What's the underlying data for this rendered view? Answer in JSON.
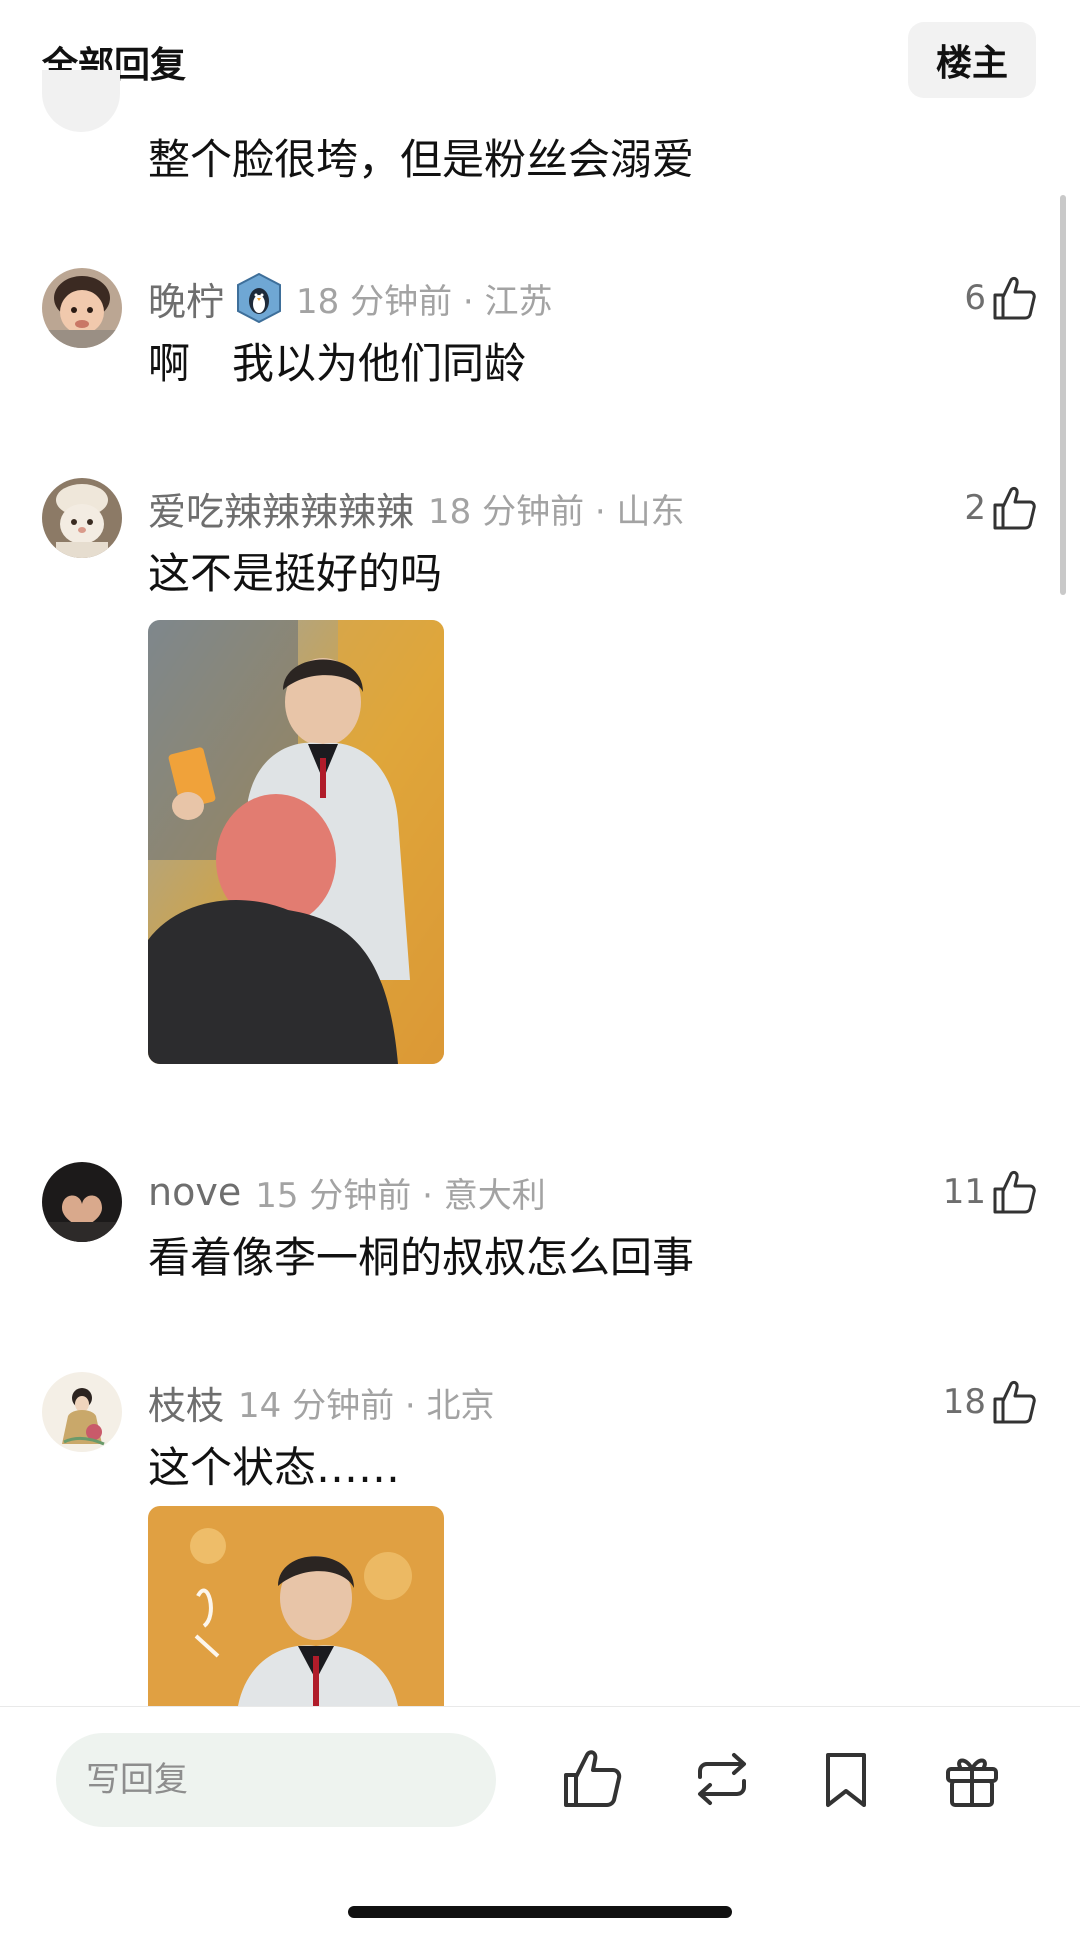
{
  "header": {
    "title": "全部回复",
    "op_button": "楼主"
  },
  "partial_comment": {
    "text": "整个脸很垮，但是粉丝会溺爱"
  },
  "comments": [
    {
      "username": "晚柠",
      "time_location": "18 分钟前 · 江苏",
      "likes": "6",
      "text": "啊　我以为他们同龄",
      "badge": "penguin-badge-icon"
    },
    {
      "username": "爱吃辣辣辣辣辣",
      "time_location": "18 分钟前 · 山东",
      "likes": "2",
      "text": "这不是挺好的吗",
      "image": "photo of man in white jacket holding orange card, red-haired person in foreground"
    },
    {
      "username": "nove",
      "time_location": "15 分钟前 · 意大利",
      "likes": "11",
      "text": "看着像李一桐的叔叔怎么回事"
    },
    {
      "username": "枝枝",
      "time_location": "14 分钟前 · 北京",
      "likes": "18",
      "text": "这个状态……",
      "image": "photo of man in white jacket on orange background"
    }
  ],
  "bottom_bar": {
    "reply_placeholder": "写回复"
  },
  "colors": {
    "secondary_text": "#6e6e6e",
    "meta_text": "#a3a3a3",
    "input_bg": "#eef3ef"
  }
}
